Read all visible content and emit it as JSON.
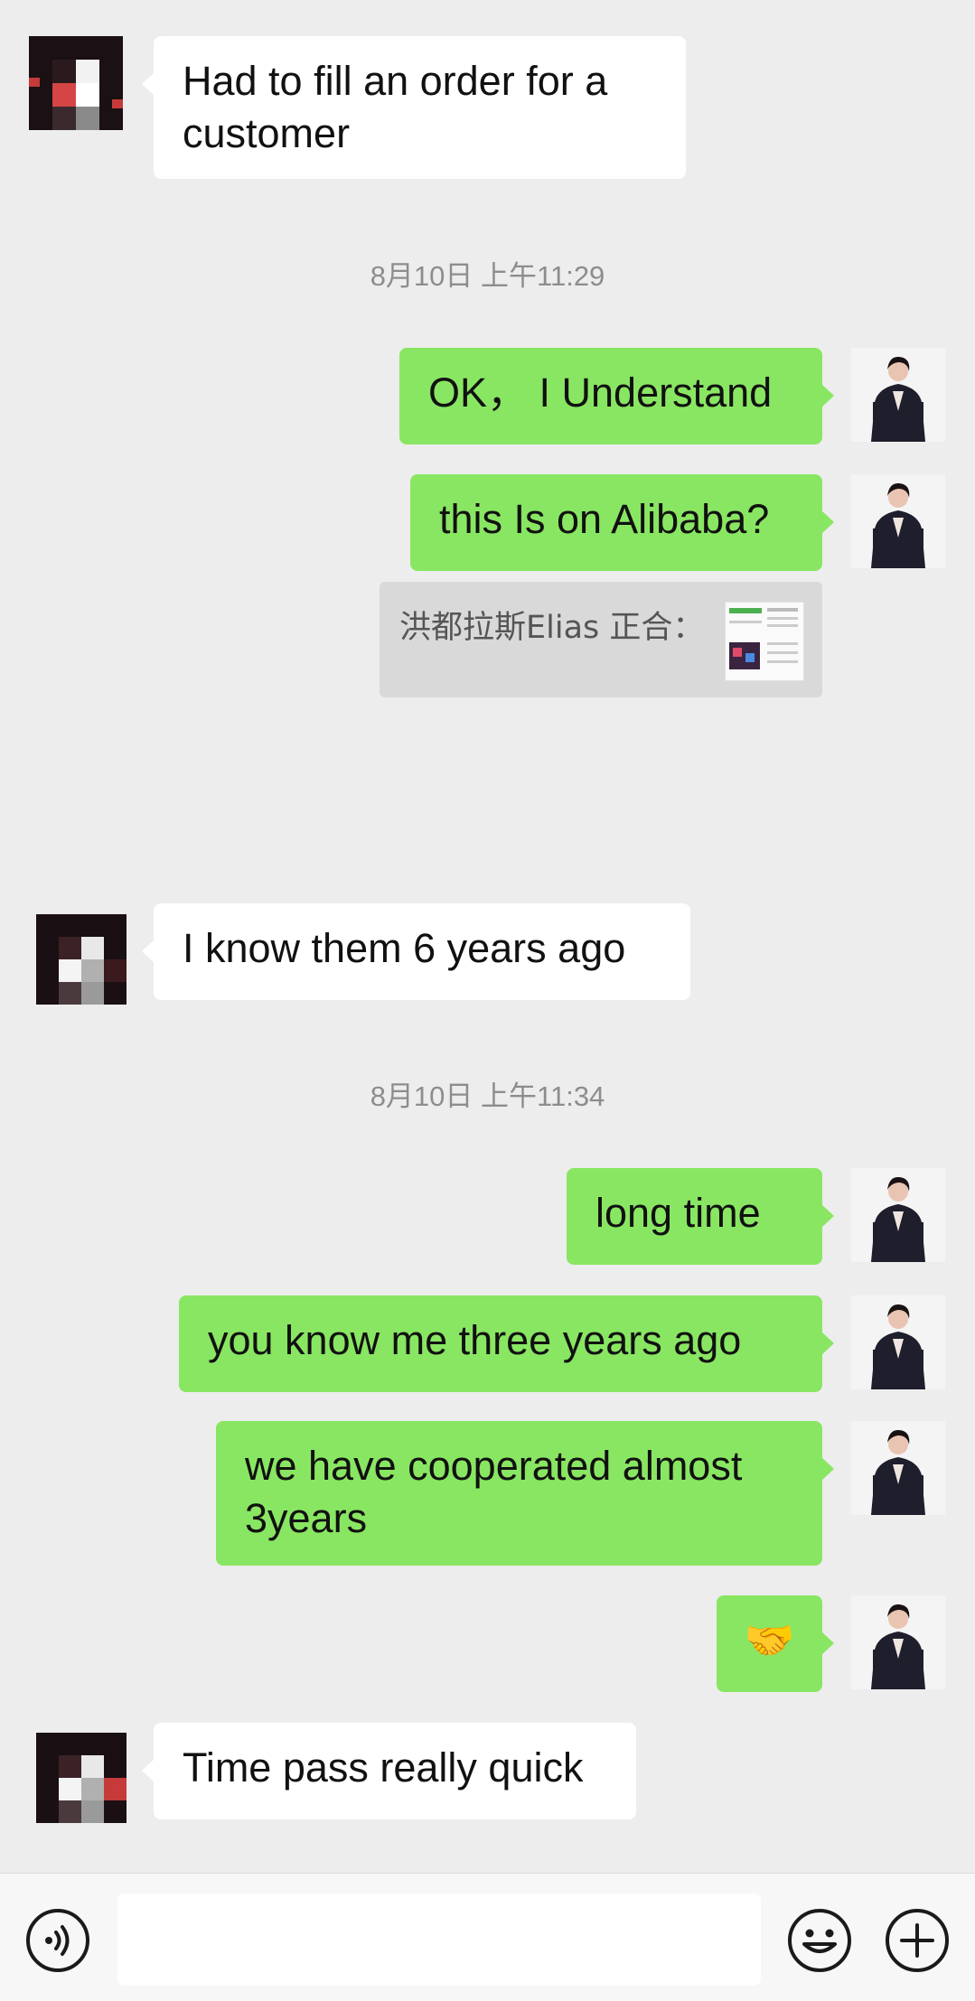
{
  "messages": {
    "m1": {
      "sender": "contact",
      "text": "Had to fill an order for a customer"
    },
    "ts1": "8月10日 上午11:29",
    "m2": {
      "sender": "me",
      "text": "OK， I Understand"
    },
    "m3": {
      "sender": "me",
      "text": "this Is on Alibaba?"
    },
    "m3_quote": "洪都拉斯Elias 正合：",
    "m4": {
      "sender": "contact",
      "text": "I know them 6 years ago"
    },
    "ts2": "8月10日 上午11:34",
    "m5": {
      "sender": "me",
      "text": "long time"
    },
    "m6": {
      "sender": "me",
      "text": "you know me three years ago"
    },
    "m7": {
      "sender": "me",
      "text": "we have cooperated almost 3years"
    },
    "m8": {
      "sender": "me",
      "text": "🤝"
    },
    "m9": {
      "sender": "contact",
      "text": "Time pass really quick"
    }
  },
  "input_bar": {
    "voice_icon": "voice-icon",
    "emoji_icon": "emoji-icon",
    "add_icon": "plus-circle-icon",
    "input_value": ""
  },
  "colors": {
    "background": "#ededed",
    "outgoing_bubble": "#89e662",
    "incoming_bubble": "#ffffff",
    "timestamp": "#8d8d8d"
  }
}
